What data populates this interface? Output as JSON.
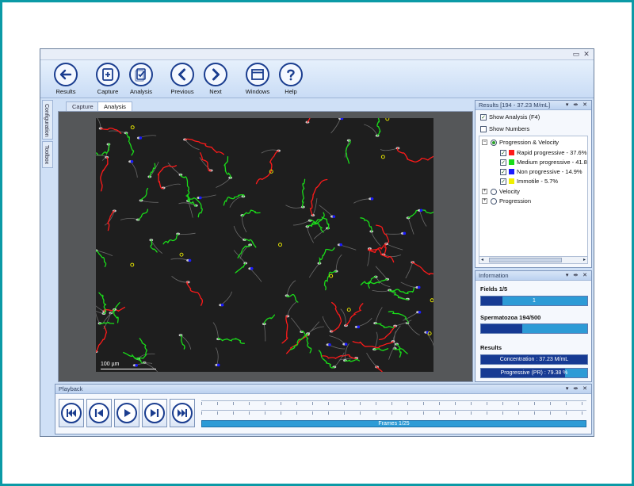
{
  "window": {
    "minimize": "▭",
    "close": "✕"
  },
  "ribbon": [
    {
      "name": "results",
      "label": "Results",
      "icon": "arrow-left-icon"
    },
    {
      "name": "capture",
      "label": "Capture",
      "icon": "capture-icon"
    },
    {
      "name": "analysis",
      "label": "Analysis",
      "icon": "analysis-icon"
    },
    {
      "name": "previous",
      "label": "Previous",
      "icon": "chevron-left-icon"
    },
    {
      "name": "next",
      "label": "Next",
      "icon": "chevron-right-icon"
    },
    {
      "name": "windows",
      "label": "Windows",
      "icon": "window-icon"
    },
    {
      "name": "help",
      "label": "Help",
      "icon": "question-icon"
    }
  ],
  "side_tabs": [
    "Configuration",
    "Toolbox"
  ],
  "doc_tabs": [
    "Capture",
    "Analysis"
  ],
  "active_doc_tab": "Analysis",
  "image": {
    "scale_label": "100 µm"
  },
  "results": {
    "title": "Results [194 - 37.23 M/mL]",
    "show_analysis": {
      "label": "Show Analysis (F4)",
      "checked": true
    },
    "show_numbers": {
      "label": "Show Numbers",
      "checked": false
    },
    "tree": {
      "group_label": "Progression & Velocity",
      "items": [
        {
          "label": "Rapid progressive - 37.6%",
          "color": "#ff1a1a",
          "checked": true
        },
        {
          "label": "Medium progressive - 41.8",
          "color": "#1adc1a",
          "checked": true
        },
        {
          "label": "Non progressive - 14.9%",
          "color": "#1a1aff",
          "checked": true
        },
        {
          "label": "Immotile - 5.7%",
          "color": "#f0f000",
          "checked": true
        }
      ],
      "other_groups": [
        "Velocity",
        "Progression"
      ]
    }
  },
  "information": {
    "title": "Information",
    "fields": {
      "label": "Fields 1/5",
      "value_text": "1",
      "fraction": 0.2
    },
    "spermatozoa": {
      "label": "Spermatozoa 194/500",
      "fraction": 0.388
    },
    "results_label": "Results",
    "concentration": {
      "text": "Concentration : 37.23 M/mL"
    },
    "progressive": {
      "text": "Progressive (PR) : 79.38 %",
      "fraction": 0.7938
    }
  },
  "playback": {
    "title": "Playback",
    "buttons": [
      "first-frame",
      "previous-frame",
      "play",
      "next-frame",
      "last-frame"
    ],
    "frames_label": "Frames 1/25"
  },
  "colors": {
    "rapid": "#ff1a1a",
    "medium": "#1adc1a",
    "non_progressive": "#1a1aff",
    "immotile": "#f0f000",
    "accent": "#1a3d8f"
  }
}
